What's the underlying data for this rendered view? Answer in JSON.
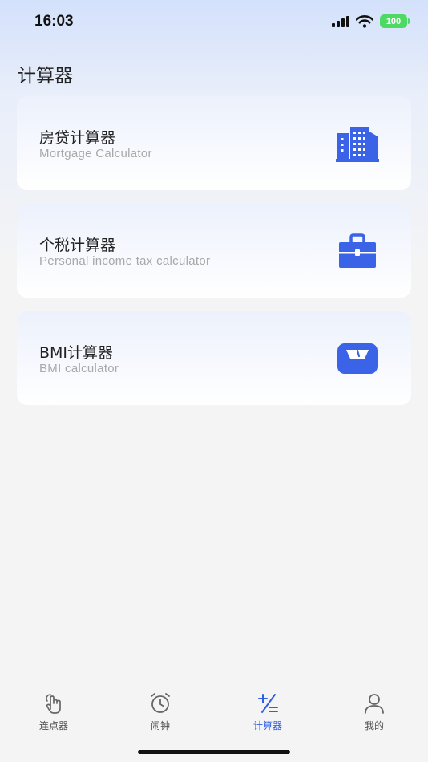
{
  "status": {
    "time": "16:03",
    "battery": "100"
  },
  "page": {
    "title": "计算器"
  },
  "cards": [
    {
      "title": "房贷计算器",
      "subtitle": "Mortgage Calculator",
      "icon": "building-icon"
    },
    {
      "title": "个税计算器",
      "subtitle": "Personal income tax calculator",
      "icon": "briefcase-icon"
    },
    {
      "title": "BMI计算器",
      "subtitle": "BMI calculator",
      "icon": "scale-icon"
    }
  ],
  "tabs": [
    {
      "label": "连点器",
      "icon": "tap-hand-icon",
      "active": false
    },
    {
      "label": "闹钟",
      "icon": "alarm-clock-icon",
      "active": false
    },
    {
      "label": "计算器",
      "icon": "calculator-icon",
      "active": true
    },
    {
      "label": "我的",
      "icon": "person-icon",
      "active": false
    }
  ],
  "colors": {
    "accent": "#2f5de6",
    "icon_blue": "#3a63e8",
    "battery": "#4cd964"
  }
}
